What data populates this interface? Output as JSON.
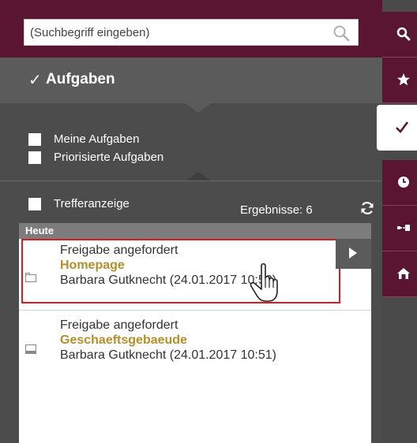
{
  "search": {
    "placeholder": "(Suchbegriff eingeben)"
  },
  "section": {
    "title": "Aufgaben",
    "check_glyph": "✓"
  },
  "filters": [
    {
      "label": "Meine Aufgaben"
    },
    {
      "label": "Priorisierte Aufgaben"
    },
    {
      "label": "Trefferanzeige"
    }
  ],
  "results": {
    "label": "Ergebnisse: 6"
  },
  "list": {
    "group_header": "Heute",
    "items": [
      {
        "title": "Freigabe angefordert",
        "object": "Homepage",
        "meta": "Barbara Gutknecht (24.01.2017 10:52)"
      },
      {
        "title": "Freigabe angefordert",
        "object": "Geschaeftsgebaeude",
        "meta": "Barbara Gutknecht (24.01.2017 10:51)"
      }
    ]
  },
  "nav": {
    "icons": [
      "search-icon",
      "star-icon",
      "check-icon",
      "clock-icon",
      "workflow-icon",
      "home-icon"
    ],
    "active": "check-icon"
  },
  "colors": {
    "brand": "#5a1532",
    "object_text": "#b68e2a",
    "highlight": "#e0191f"
  }
}
